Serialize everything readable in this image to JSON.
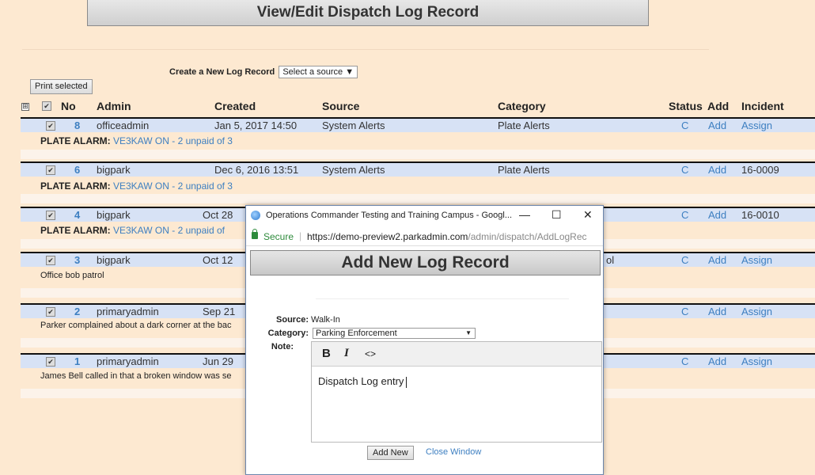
{
  "page": {
    "title": "View/Edit Dispatch Log Record",
    "create_label": "Create a New Log Record",
    "source_select": "Select a source",
    "print_button": "Print selected"
  },
  "table": {
    "headers": {
      "expand": "⊞",
      "check": "✔",
      "no": "No",
      "admin": "Admin",
      "created": "Created",
      "source": "Source",
      "category": "Category",
      "status": "Status",
      "add": "Add",
      "incident": "Incident"
    },
    "rows": [
      {
        "no": "8",
        "admin": "officeadmin",
        "created": "Jan 5, 2017 14:50",
        "source": "System Alerts",
        "category": "Plate Alerts",
        "status": "C",
        "add": "Add",
        "incident": "Assign",
        "note_prefix": "PLATE ALARM:",
        "note_link": "VE3KAW ON - 2 unpaid of 3"
      },
      {
        "no": "6",
        "admin": "bigpark",
        "created": "Dec 6, 2016 13:51",
        "source": "System Alerts",
        "category": "Plate Alerts",
        "status": "C",
        "add": "Add",
        "incident": "16-0009",
        "note_prefix": "PLATE ALARM:",
        "note_link": "VE3KAW ON - 2 unpaid of 3"
      },
      {
        "no": "4",
        "admin": "bigpark",
        "created": "Oct 28",
        "source": "",
        "category": "",
        "status": "C",
        "add": "Add",
        "incident": "16-0010",
        "note_prefix": "PLATE ALARM:",
        "note_link": "VE3KAW ON - 2 unpaid of"
      },
      {
        "no": "3",
        "admin": "bigpark",
        "created": "Oct 12",
        "source": "",
        "category": "ol",
        "status": "C",
        "add": "Add",
        "incident": "Assign",
        "note": "Office bob  patrol"
      },
      {
        "no": "2",
        "admin": "primaryadmin",
        "created": "Sep 21",
        "source": "",
        "category": "",
        "status": "C",
        "add": "Add",
        "incident": "Assign",
        "note": "Parker complained about a dark corner at the bac"
      },
      {
        "no": "1",
        "admin": "primaryadmin",
        "created": "Jun 29",
        "source": "",
        "category": "",
        "status": "C",
        "add": "Add",
        "incident": "Assign",
        "note": "James Bell called in that a broken window was se"
      }
    ]
  },
  "popup": {
    "window_title": "Operations Commander Testing and Training Campus - Googl...",
    "controls": {
      "minimize": "—",
      "maximize": "☐",
      "close": "✕"
    },
    "secure": "Secure",
    "url_host": "https://demo-preview2.parkadmin.com",
    "url_path": "/admin/dispatch/AddLogRec",
    "heading": "Add New Log Record",
    "source_label": "Source:",
    "source_value": "Walk-In",
    "category_label": "Category:",
    "category_value": "Parking Enforcement",
    "note_label": "Note:",
    "toolbar": {
      "bold": "B",
      "italic": "I",
      "code": "<>"
    },
    "note_text": "Dispatch Log entry",
    "add_new_button": "Add New",
    "close_link": "Close Window"
  }
}
